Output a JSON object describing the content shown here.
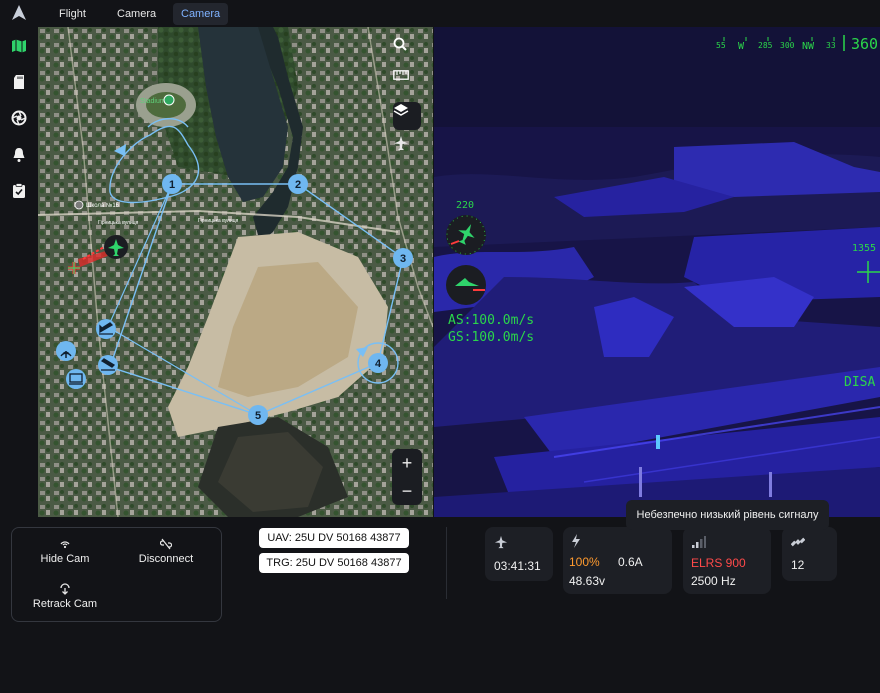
{
  "app": {
    "logo_icon": "ardupilot-arrow-icon"
  },
  "tabs": [
    {
      "label": "Flight",
      "active": false
    },
    {
      "label": "Camera",
      "active": false
    },
    {
      "label": "Camera",
      "active": true
    }
  ],
  "sidebar": {
    "items": [
      {
        "icon": "map-icon",
        "active": true
      },
      {
        "icon": "sd-card-icon",
        "active": false
      },
      {
        "icon": "aperture-icon",
        "active": false
      },
      {
        "icon": "bell-icon",
        "active": false
      },
      {
        "icon": "clipboard-check-icon",
        "active": false
      }
    ]
  },
  "map": {
    "waypoints": [
      "1",
      "2",
      "3",
      "4",
      "5"
    ],
    "labels": {
      "stadium": "Stadium",
      "school": "Школа №16",
      "street_a": "Гірницька вулиця",
      "street_b": "Гірницька вулиця"
    },
    "tools": [
      "search-icon",
      "ruler-icon",
      "layers-icon",
      "airplane-icon"
    ],
    "zoom_in": "+",
    "zoom_out": "−"
  },
  "camera": {
    "heading_scale": [
      "55",
      "W",
      "285",
      "300",
      "NW",
      "33"
    ],
    "heading_value": "360",
    "pitch_value": "220",
    "roll_value": "45",
    "airspeed": "AS:100.0m/s",
    "groundspeed": "GS:100.0m/s",
    "altitude_right": "1355",
    "status_right": "DISA"
  },
  "controls": {
    "hide_cam": "Hide Cam",
    "disconnect": "Disconnect",
    "retrack_cam": "Retrack Cam"
  },
  "coords": {
    "uav": "UAV: 25U DV 50168 43877",
    "trg": "TRG: 25U DV 50168 43877"
  },
  "telemetry": {
    "flight_time": "03:41:31",
    "battery_percent": "100%",
    "battery_current": "0.6A",
    "battery_voltage": "48.63v",
    "link_name": "ELRS 900",
    "link_rate": "2500 Hz",
    "satellites": "12",
    "tooltip": "Небезпечно низький рівень сигналу"
  },
  "colors": {
    "accent": "#7fb2ff",
    "hud_green": "#2bd64a",
    "warning_orange": "#ff9a2e",
    "danger_red": "#ff4a4a",
    "waypoint_blue": "#6fb7f0"
  }
}
